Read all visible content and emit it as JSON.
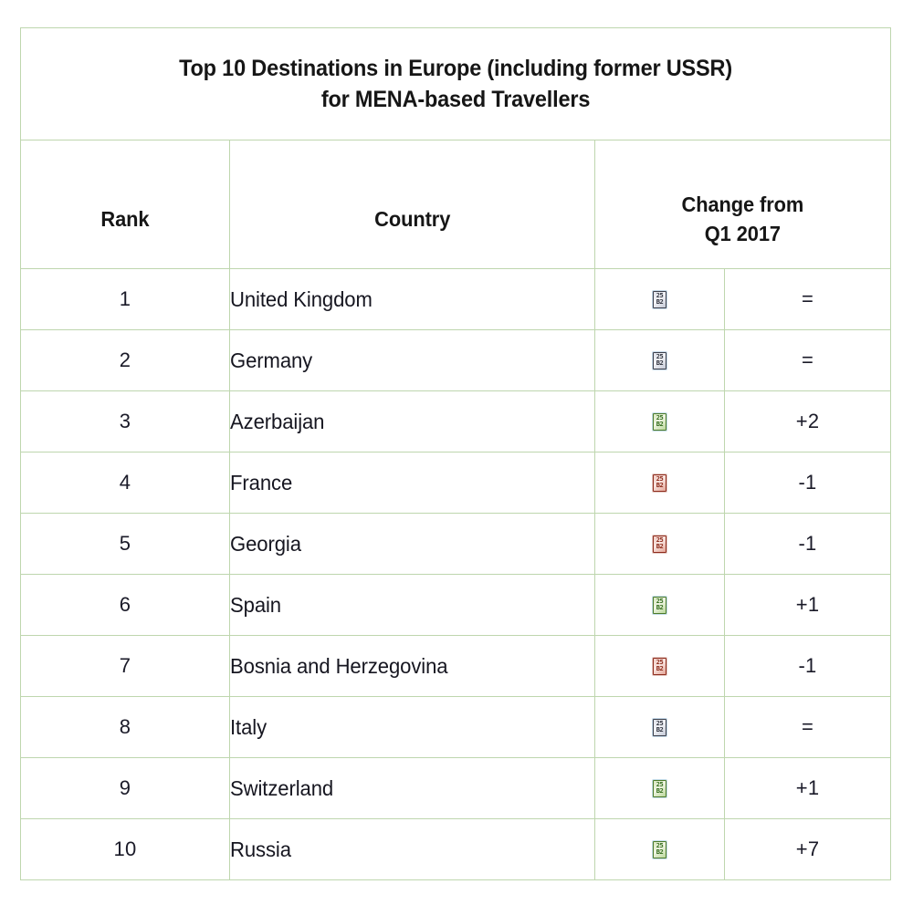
{
  "table": {
    "title": "Top 10 Destinations in Europe (including former USSR)\nfor MENA-based Travellers",
    "columns": {
      "rank": "Rank",
      "country": "Country",
      "change": "Change from\nQ1 2017"
    },
    "colors": {
      "border": "#bed6ae",
      "text": "#161616",
      "up": "#2f6a18",
      "down": "#8a2413",
      "same": "#2b2f3a",
      "background": "#ffffff"
    },
    "rows": [
      {
        "rank": "1",
        "country": "United Kingdom",
        "direction": "same",
        "icon": "no-change-icon",
        "value": "="
      },
      {
        "rank": "2",
        "country": "Germany",
        "direction": "same",
        "icon": "no-change-icon",
        "value": "="
      },
      {
        "rank": "3",
        "country": "Azerbaijan",
        "direction": "up",
        "icon": "arrow-up-icon",
        "value": "+2"
      },
      {
        "rank": "4",
        "country": "France",
        "direction": "down",
        "icon": "arrow-down-icon",
        "value": "-1"
      },
      {
        "rank": "5",
        "country": "Georgia",
        "direction": "down",
        "icon": "arrow-down-icon",
        "value": "-1"
      },
      {
        "rank": "6",
        "country": "Spain",
        "direction": "up",
        "icon": "arrow-up-icon",
        "value": "+1"
      },
      {
        "rank": "7",
        "country": "Bosnia and Herzegovina",
        "direction": "down",
        "icon": "arrow-down-icon",
        "value": "-1"
      },
      {
        "rank": "8",
        "country": "Italy",
        "direction": "same",
        "icon": "no-change-icon",
        "value": "="
      },
      {
        "rank": "9",
        "country": "Switzerland",
        "direction": "up",
        "icon": "arrow-up-icon",
        "value": "+1"
      },
      {
        "rank": "10",
        "country": "Russia",
        "direction": "up",
        "icon": "arrow-up-icon",
        "value": "+7"
      }
    ]
  },
  "chart_data": {
    "type": "table",
    "title": "Top 10 Destinations in Europe (including former USSR) for MENA-based Travellers",
    "columns": [
      "Rank",
      "Country",
      "Change from Q1 2017"
    ],
    "rows": [
      [
        "1",
        "United Kingdom",
        "="
      ],
      [
        "2",
        "Germany",
        "="
      ],
      [
        "3",
        "Azerbaijan",
        "+2"
      ],
      [
        "4",
        "France",
        "-1"
      ],
      [
        "5",
        "Georgia",
        "-1"
      ],
      [
        "6",
        "Spain",
        "+1"
      ],
      [
        "7",
        "Bosnia and Herzegovina",
        "-1"
      ],
      [
        "8",
        "Italy",
        "="
      ],
      [
        "9",
        "Switzerland",
        "+1"
      ],
      [
        "10",
        "Russia",
        "+7"
      ]
    ]
  }
}
